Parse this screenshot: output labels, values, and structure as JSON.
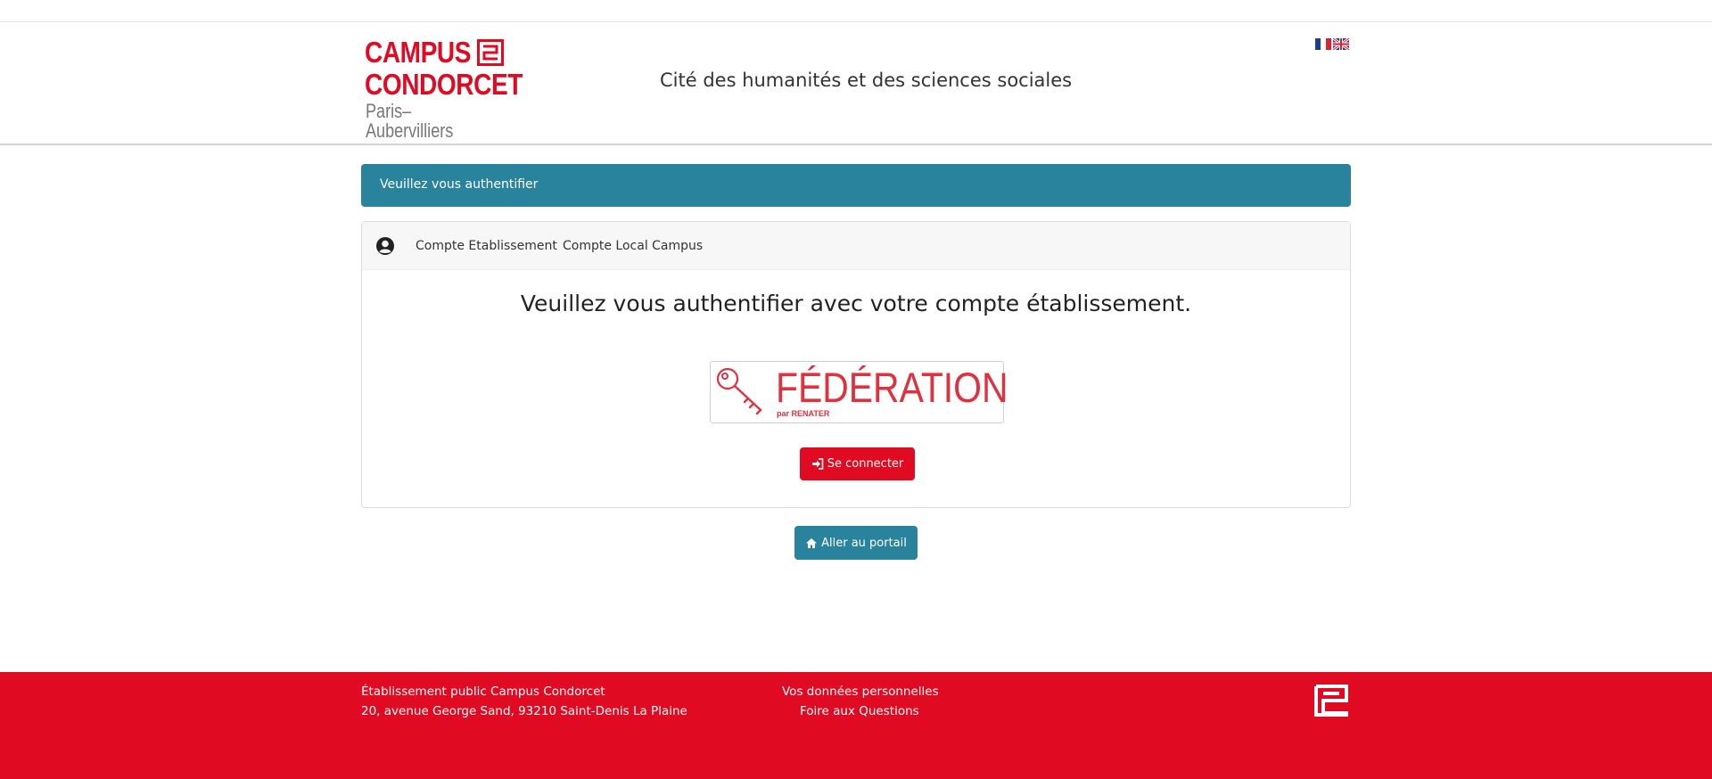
{
  "header": {
    "logo": {
      "line1": "CAMPUS",
      "line2": "CONDORCET",
      "subtitle": "Paris–Aubervilliers"
    },
    "tagline": "Cité des humanités et des sciences sociales",
    "languages": [
      {
        "code": "fr",
        "icon": "flag-fr-icon"
      },
      {
        "code": "en",
        "icon": "flag-uk-icon"
      }
    ]
  },
  "alert": {
    "text": "Veuillez vous authentifier"
  },
  "card": {
    "tabs": [
      {
        "label": "Compte Etablissement"
      },
      {
        "label": "Compte Local Campus"
      }
    ],
    "title": "Veuillez vous authentifier avec votre compte établissement.",
    "federation": {
      "word": "FÉDÉRATION",
      "by": "par RENATER"
    },
    "connect_label": "Se connecter"
  },
  "portal_label": "Aller au portail",
  "footer": {
    "address_line1": "Établissement public Campus Condorcet",
    "address_line2": "20, avenue George Sand, 93210 Saint-Denis La Plaine",
    "link1": "Vos données personnelles",
    "link2": "Foire aux Questions"
  },
  "colors": {
    "brand_red": "#e00a22",
    "teal": "#2a839c"
  }
}
